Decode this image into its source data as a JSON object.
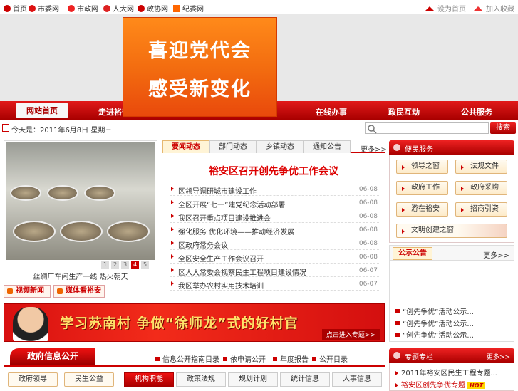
{
  "topbar": {
    "links": [
      "首页",
      "市委网",
      "市政网",
      "人大网",
      "政协网",
      "纪委网"
    ],
    "right": [
      "设为首页",
      "加入收藏"
    ]
  },
  "banner": {
    "line1": "喜迎党代会",
    "line2": "感受新变化"
  },
  "nav": {
    "home": "网站首页",
    "items": [
      "走进裕安",
      "在线办事",
      "政民互动",
      "公共服务"
    ]
  },
  "infobar": {
    "date": "今天是：2011年6月8日 星期三",
    "search_label": "搜索"
  },
  "photo": {
    "pages": [
      "1",
      "2",
      "3",
      "4",
      "5"
    ],
    "active_page": "4",
    "caption": "丝绸厂车间生产一线 热火朝天"
  },
  "quick": {
    "video": "视频新闻",
    "media": "媒体看裕安"
  },
  "news": {
    "tabs": [
      "要闻动态",
      "部门动态",
      "乡镇动态",
      "通知公告"
    ],
    "more": "更多>>",
    "headline": "裕安区召开创先争优工作会议",
    "items": [
      {
        "title": "区领导调研城市建设工作",
        "date": "06-08"
      },
      {
        "title": "全区开展“七一”建党纪念活动部署",
        "date": "06-08"
      },
      {
        "title": "我区召开重点项目建设推进会",
        "date": "06-08"
      },
      {
        "title": "强化服务 优化环境——推动经济发展",
        "date": "06-08"
      },
      {
        "title": "区政府常务会议",
        "date": "06-08"
      },
      {
        "title": "全区安全生产工作会议召开",
        "date": "06-08"
      },
      {
        "title": "区人大常委会视察民生工程项目建设情况",
        "date": "06-07"
      },
      {
        "title": "我区举办农村实用技术培训",
        "date": "06-07"
      }
    ]
  },
  "services": {
    "title": "便民服务",
    "items": [
      "领导之窗",
      "法规文件",
      "政府工作",
      "政府采购",
      "游在裕安",
      "招商引资"
    ],
    "civil": "文明创建之窗"
  },
  "notice": {
    "tab": "公示公告",
    "more": "更多>>",
    "links": [
      "“创先争优”活动公示...",
      "“创先争优”活动公示...",
      "“创先争优”活动公示..."
    ]
  },
  "special": {
    "title": "专题专栏",
    "more": "更多>>",
    "links": [
      "2011年裕安区民生工程专题...",
      "裕安区创先争优专题"
    ],
    "hot": "HOT"
  },
  "promo": {
    "text": "学习苏南村  争做“徐师龙”式的好村官",
    "link": "点击进入专题>>"
  },
  "gov": {
    "title": "政府信息公开",
    "links": [
      "信息公开指南目录",
      "依申请公开",
      "年度报告",
      "公开目录"
    ],
    "tabs": [
      "政府领导",
      "民生公益",
      "机构职能",
      "政策法规",
      "规划计划",
      "统计信息",
      "人事信息"
    ],
    "active_tab": "机构职能"
  },
  "colors": {
    "brand_red": "#c00000",
    "banner_orange": "#f26a0f",
    "promo_yellow": "#ffe26a"
  }
}
